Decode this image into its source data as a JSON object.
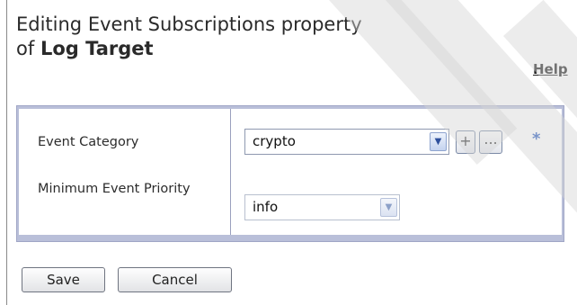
{
  "title": {
    "line1": "Editing Event Subscriptions property",
    "prefix": "of",
    "object": "Log Target"
  },
  "help_link": "Help",
  "form": {
    "fields": [
      {
        "label": "Event Category",
        "value": "crypto",
        "required_marker": "*"
      },
      {
        "label": "Minimum Event Priority",
        "value": "info"
      }
    ],
    "add_button": "+",
    "browse_button": "..."
  },
  "buttons": {
    "save": "Save",
    "cancel": "Cancel"
  },
  "icons": {
    "dropdown": "chevron-down-icon"
  },
  "colors": {
    "panel_border": "#b9bfd9",
    "required": "#2f5fbf"
  }
}
